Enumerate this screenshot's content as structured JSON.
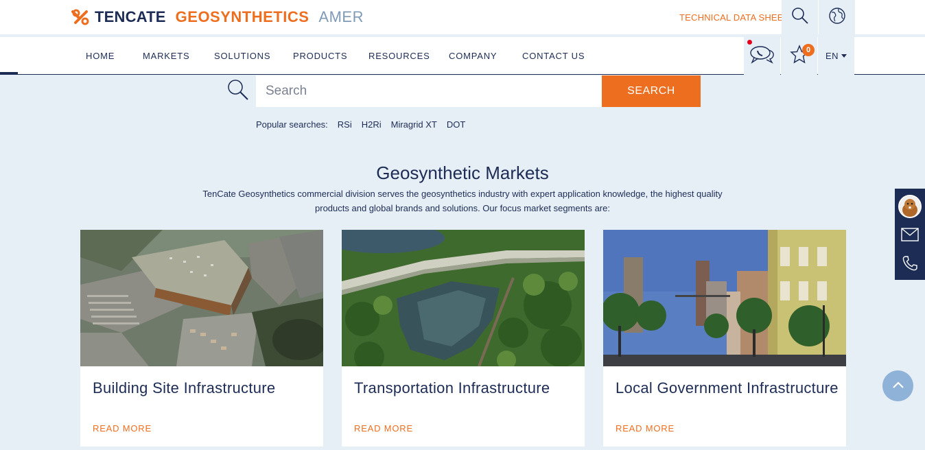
{
  "header": {
    "brand": "TENCATE",
    "product_line": "GEOSYNTHETICS",
    "region": "AMER",
    "technical_link": "TECHNICAL DATA SHEETS",
    "search_icon": "search-icon",
    "globe_icon": "globe-icon"
  },
  "nav": {
    "items": [
      "HOME",
      "MARKETS",
      "SOLUTIONS",
      "PRODUCTS",
      "RESOURCES",
      "COMPANY",
      "CONTACT US"
    ],
    "chat_icon": "chat-icon",
    "favorites_icon": "star-icon",
    "favorites_count": "0",
    "language": "EN"
  },
  "search": {
    "placeholder": "Search",
    "button_label": "SEARCH",
    "popular_label": "Popular searches:",
    "popular_terms": [
      "RSi",
      "H2Ri",
      "Miragrid XT",
      "DOT"
    ]
  },
  "markets": {
    "title": "Geosynthetic Markets",
    "description": "TenCate Geosynthetics commercial division serves the geosynthetics industry with expert application knowledge, the highest quality products and global brands and solutions.  Our focus market segments are:",
    "cards": [
      {
        "title": "Building Site Infrastructure",
        "link": "READ MORE",
        "image": "aerial-building-site-photo"
      },
      {
        "title": "Transportation Infrastructure",
        "link": "READ MORE",
        "image": "aerial-highway-lake-photo"
      },
      {
        "title": "Local Government Infrastructure",
        "link": "READ MORE",
        "image": "town-main-street-photo"
      }
    ]
  },
  "side_contact": {
    "avatar_icon": "beaver-avatar-icon",
    "mail_icon": "mail-icon",
    "phone_icon": "phone-icon"
  },
  "back_to_top_icon": "chevron-up-icon",
  "colors": {
    "navy": "#1c2c55",
    "orange": "#ee6e1f",
    "background": "#e6eef6"
  }
}
